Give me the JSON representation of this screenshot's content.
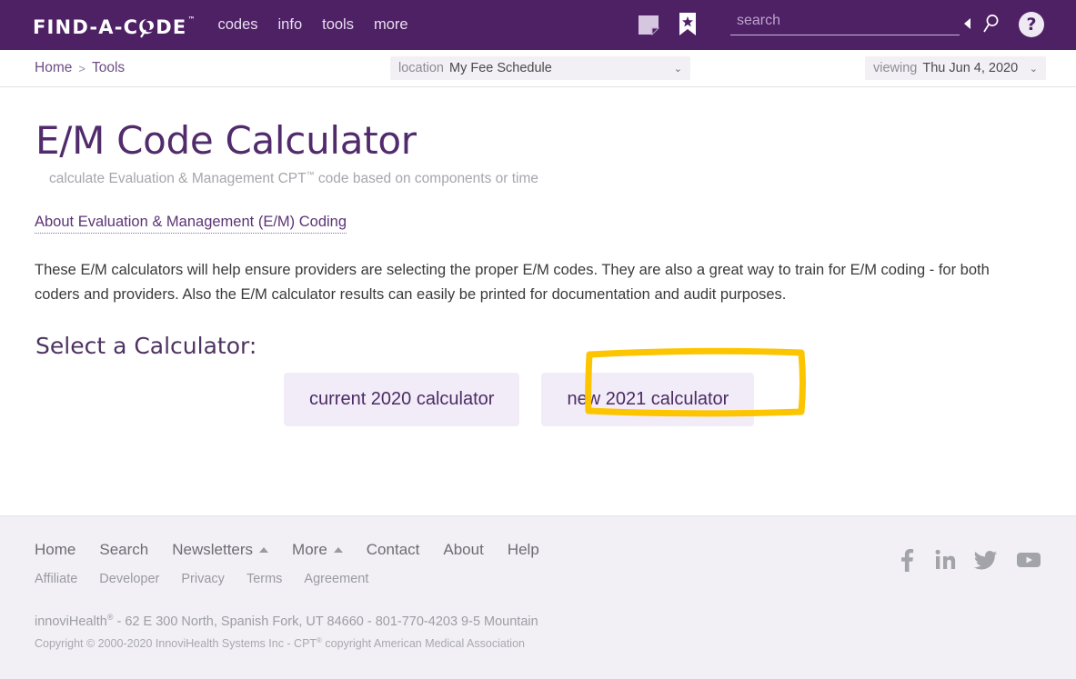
{
  "header": {
    "logo_text": "FIND-A-CODE",
    "logo_tm": "™",
    "nav": [
      {
        "label": "codes"
      },
      {
        "label": "info"
      },
      {
        "label": "tools"
      },
      {
        "label": "more"
      }
    ],
    "icons": [
      {
        "name": "note-icon"
      },
      {
        "name": "bookmark-star-icon"
      }
    ],
    "search": {
      "placeholder": "search",
      "value": ""
    },
    "collapse_icon": "left-triangle-icon",
    "search_icon": "magnifier-icon",
    "help_label": "?"
  },
  "subbar": {
    "breadcrumb": [
      {
        "label": "Home"
      },
      {
        "label": "Tools"
      }
    ],
    "breadcrumb_separator": ">",
    "location": {
      "label": "location",
      "value": "My Fee Schedule",
      "caret": "⌄"
    },
    "viewing": {
      "label": "viewing",
      "value": "Thu Jun 4, 2020",
      "caret": "⌄"
    }
  },
  "main": {
    "title": "E/M Code Calculator",
    "subtitle_pre": "calculate Evaluation & Management CPT",
    "subtitle_tm": "™",
    "subtitle_post": " code based on components or time",
    "about_link": "About Evaluation & Management (E/M) Coding",
    "body_copy": "These E/M calculators will help ensure providers are selecting the proper E/M codes. They are also a great way to train for E/M coding - for both coders and providers. Also the E/M calculator results can easily be printed for documentation and audit purposes.",
    "select_heading": "Select a Calculator:",
    "calculators": [
      {
        "label": "current 2020 calculator",
        "highlighted": false
      },
      {
        "label": "new 2021 calculator",
        "highlighted": true
      }
    ],
    "highlight_color": "#fdc500"
  },
  "footer": {
    "primary_links": [
      {
        "label": "Home",
        "caret": false
      },
      {
        "label": "Search",
        "caret": false
      },
      {
        "label": "Newsletters",
        "caret": true
      },
      {
        "label": "More",
        "caret": true
      },
      {
        "label": "Contact",
        "caret": false
      },
      {
        "label": "About",
        "caret": false
      },
      {
        "label": "Help",
        "caret": false
      }
    ],
    "secondary_links": [
      {
        "label": "Affiliate"
      },
      {
        "label": "Developer"
      },
      {
        "label": "Privacy"
      },
      {
        "label": "Terms"
      },
      {
        "label": "Agreement"
      }
    ],
    "social": [
      {
        "name": "facebook-icon"
      },
      {
        "name": "linkedin-icon"
      },
      {
        "name": "twitter-icon"
      },
      {
        "name": "youtube-icon"
      }
    ],
    "legal_line1_pre": "innoviHealth",
    "legal_line1_sup": "®",
    "legal_line1_post": " - 62 E 300 North, Spanish Fork, UT 84660 - 801-770-4203 9-5 Mountain",
    "legal_line2_pre": "Copyright © 2000-2020 InnoviHealth Systems Inc - CPT",
    "legal_line2_sup": "®",
    "legal_line2_post": " copyright American Medical Association"
  },
  "colors": {
    "brand_purple": "#4e2064",
    "button_lavender": "#f2ecf9",
    "footer_gray": "#f2f0f5",
    "highlight_yellow": "#fdc500"
  }
}
